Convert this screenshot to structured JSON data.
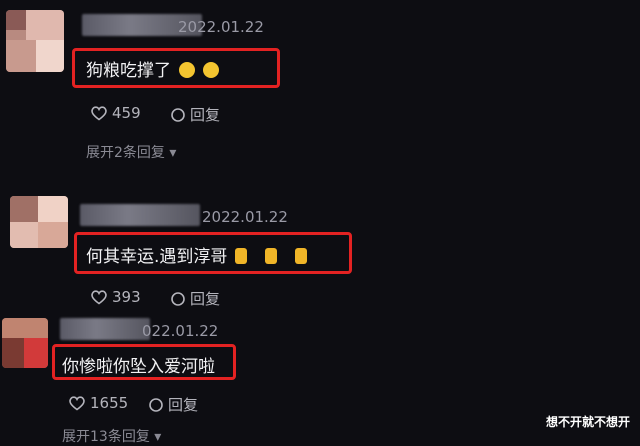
{
  "comments": [
    {
      "date": "2022.01.22",
      "text": "狗粮吃撑了",
      "likes": "459",
      "reply_label": "回复",
      "expand_label": "展开2条回复",
      "emoji_icon": "laughing-crying-face-icon"
    },
    {
      "date": "2022.01.22",
      "text": "何其幸运.遇到淳哥",
      "likes": "393",
      "reply_label": "回复",
      "emoji_icon": "fingers-crossed-heart-icon"
    },
    {
      "date": "022.01.22",
      "text": "你惨啦你坠入爱河啦",
      "likes": "1655",
      "reply_label": "回复",
      "expand_label": "展开13条回复"
    }
  ],
  "watermark": "想不开就不想开",
  "colors": {
    "highlight_border": "#e32222",
    "background": "#0d0d12"
  }
}
